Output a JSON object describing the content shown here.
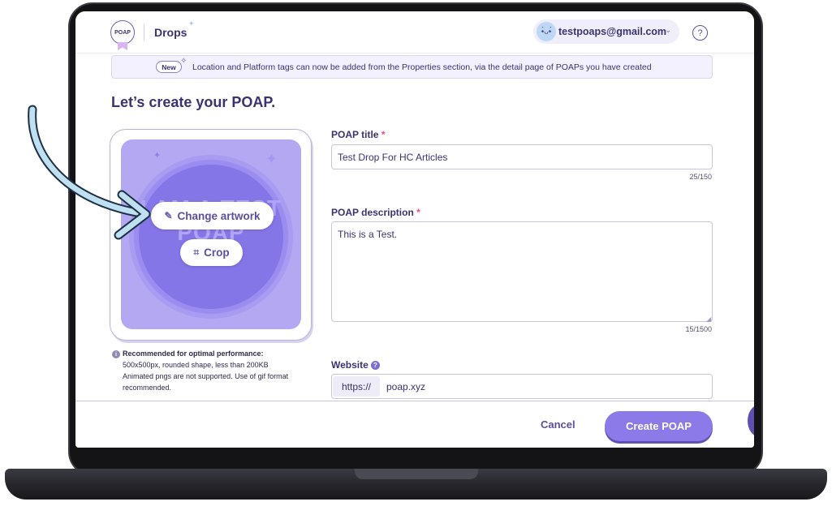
{
  "header": {
    "logo_text": "POAP",
    "section": "Drops",
    "account_email": "testpoaps@gmail.com",
    "help_symbol": "?"
  },
  "banner": {
    "badge": "New",
    "message": "Location and Platform tags can now be added from the Properties section, via the detail page of POAPs you have created"
  },
  "page_title": "Let’s create your POAP.",
  "artwork": {
    "preview_text": "I AM A TEST POAP",
    "change_label": "Change artwork",
    "crop_label": "Crop"
  },
  "recommendation": {
    "title": "Recommended for optimal performance:",
    "lines": [
      "500x500px, rounded shape, less than 200KB",
      "Animated pngs are not supported. Use of gif format",
      "recommended."
    ]
  },
  "form": {
    "title_label": "POAP title",
    "title_value": "Test Drop For HC Articles",
    "title_counter": "25/150",
    "description_label": "POAP description",
    "description_value": "This is a Test.",
    "description_counter": "15/1500",
    "required_mark": "*",
    "website_label": "Website",
    "website_prefix": "https://",
    "website_value": "poap.xyz"
  },
  "footer": {
    "cancel_label": "Cancel",
    "create_label": "Create POAP"
  },
  "icons": {
    "help": "question-circle-icon",
    "edit": "edit-icon",
    "crop": "crop-icon",
    "info": "info-icon",
    "chevron": "chevron-down-icon"
  },
  "colors": {
    "primary": "#8b7ae8",
    "text": "#3b3272",
    "artwork_bg": "#b3a8f1"
  }
}
